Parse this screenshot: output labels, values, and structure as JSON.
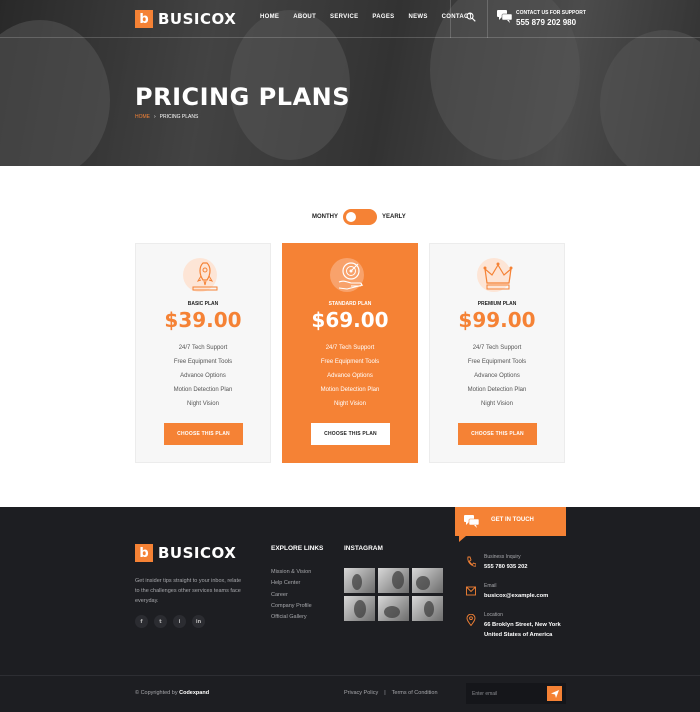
{
  "brand": {
    "mark": "b",
    "name": "BUSICOX",
    "accent": "#f58235",
    "dark": "#1d1e22"
  },
  "nav": {
    "items": [
      "HOME",
      "ABOUT",
      "SERVICE",
      "PAGES",
      "NEWS",
      "CONTACT"
    ]
  },
  "support": {
    "label": "CONTACT US FOR SUPPORT",
    "phone": "555 879 202 980"
  },
  "hero": {
    "title": "PRICING PLANS",
    "crumb_home": "HOME",
    "crumb_sep": "›",
    "crumb_current": "PRICING PLANS"
  },
  "billing": {
    "monthly": "MONTHY",
    "yearly": "YEARLY"
  },
  "plans": [
    {
      "icon": "rocket-icon",
      "name": "BASIC PLAN",
      "price": "$39.00",
      "features": [
        "24/7 Tech Support",
        "Free Equipment Tools",
        "Advance Options",
        "Motion Detection Plan",
        "Night Vision"
      ],
      "button": "CHOOSE THIS PLAN"
    },
    {
      "icon": "target-hand-icon",
      "name": "STANDARD PLAN",
      "price": "$69.00",
      "features": [
        "24/7 Tech Support",
        "Free Equipment Tools",
        "Advance Options",
        "Motion Detection Plan",
        "Night Vision"
      ],
      "button": "CHOOSE THIS PLAN"
    },
    {
      "icon": "crown-icon",
      "name": "PREMIUM PLAN",
      "price": "$99.00",
      "features": [
        "24/7 Tech Support",
        "Free Equipment Tools",
        "Advance Options",
        "Motion Detection Plan",
        "Night Vision"
      ],
      "button": "CHOOSE THIS PLAN"
    }
  ],
  "footer": {
    "get_in_touch": "GET IN TOUCH",
    "blurb": "Get insider tips straight to your inbox, relate to the challenges other services teams face everyday.",
    "socials": [
      "f",
      "t",
      "i",
      "in"
    ],
    "explore_title": "EXPLORE LINKS",
    "explore_links": [
      "Mission & Vision",
      "Help Center",
      "Career",
      "Company Profile",
      "Official Gallery"
    ],
    "instagram_title": "INSTAGRAM",
    "contacts": [
      {
        "icon": "phone-icon",
        "label": "Business Inquiry",
        "value": "555 780 935 202"
      },
      {
        "icon": "mail-icon",
        "label": "Email",
        "value": "busicox@example.com"
      },
      {
        "icon": "location-pin-icon",
        "label": "Location",
        "value_line1": "66 Broklyn Street, New York",
        "value_line2": "United States of America"
      }
    ],
    "copyright_prefix": "© Copyrighted by ",
    "copyright_brand": "Codexpand",
    "privacy": "Privacy Policy",
    "legal_sep": "|",
    "terms": "Terms of Condition",
    "newsletter_placeholder": "Enter email"
  }
}
